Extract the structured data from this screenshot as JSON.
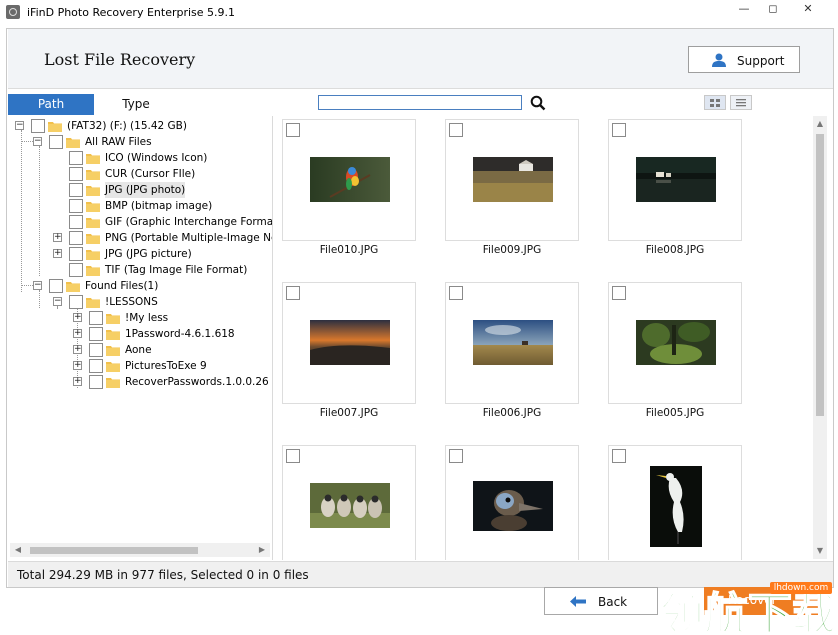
{
  "window": {
    "title": "iFinD Photo Recovery Enterprise 5.9.1",
    "minimize": "—",
    "restore": "◻",
    "close": "✕"
  },
  "header": {
    "title": "Lost File Recovery",
    "support_label": "Support"
  },
  "tabs": {
    "path": "Path",
    "type": "Type"
  },
  "search": {
    "value": "",
    "placeholder": ""
  },
  "tree": {
    "drive": "(FAT32) (F:) (15.42 GB)",
    "raw_group": "All RAW Files",
    "raw_items": [
      "ICO (Windows Icon)",
      "CUR (Cursor FIle)",
      "JPG (JPG photo)",
      "BMP (bitmap image)",
      "GIF (Graphic Interchange Format",
      "PNG (Portable Multiple-Image Ne",
      "JPG (JPG picture)",
      "TIF (Tag Image File Format)"
    ],
    "found_group": "Found Files(1)",
    "lessons": "!LESSONS",
    "lesson_items": [
      "!My less",
      "1Password-4.6.1.618",
      "Aone",
      "PicturesToExe 9",
      "RecoverPasswords.1.0.0.26"
    ]
  },
  "files": [
    {
      "name": "File010.JPG",
      "scene": "parrot"
    },
    {
      "name": "File009.JPG",
      "scene": "field-house"
    },
    {
      "name": "File008.JPG",
      "scene": "lake-night"
    },
    {
      "name": "File007.JPG",
      "scene": "sunset-coast"
    },
    {
      "name": "File006.JPG",
      "scene": "plains-sky"
    },
    {
      "name": "File005.JPG",
      "scene": "forest-moss"
    },
    {
      "name": "",
      "scene": "lemurs"
    },
    {
      "name": "",
      "scene": "emu"
    },
    {
      "name": "",
      "scene": "egret"
    }
  ],
  "status": {
    "text": "Total 294.29 MB in 977 files,  Selected 0 in 0 files"
  },
  "buttons": {
    "back": "Back",
    "recover": "Recover"
  },
  "watermark": {
    "text": "领航下载",
    "url": "lhdown.com"
  },
  "colors": {
    "accent": "#2f74c4",
    "recover": "#ef7d22",
    "folder": "#f2c04b"
  }
}
